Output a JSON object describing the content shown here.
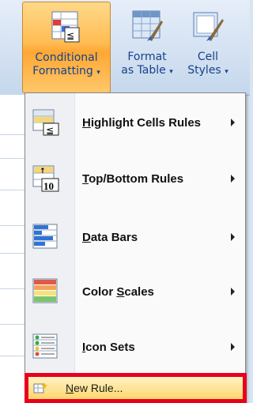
{
  "ribbon": {
    "conditional_formatting": {
      "line1": "Conditional",
      "line2": "Formatting",
      "dropdown": "▾"
    },
    "format_as_table": {
      "line1": "Format",
      "line2": "as Table",
      "dropdown": "▾"
    },
    "cell_styles": {
      "line1": "Cell",
      "line2": "Styles",
      "dropdown": "▾"
    }
  },
  "menu": {
    "items": [
      {
        "label_pre": "",
        "label_u": "H",
        "label_post": "ighlight Cells Rules",
        "icon": "highlight-cells-rules-icon",
        "has_submenu": true
      },
      {
        "label_pre": "",
        "label_u": "T",
        "label_post": "op/Bottom Rules",
        "icon": "top-bottom-rules-icon",
        "has_submenu": true
      },
      {
        "label_pre": "",
        "label_u": "D",
        "label_post": "ata Bars",
        "icon": "data-bars-icon",
        "has_submenu": true
      },
      {
        "label_pre": "Color ",
        "label_u": "S",
        "label_post": "cales",
        "icon": "color-scales-icon",
        "has_submenu": true
      },
      {
        "label_pre": "",
        "label_u": "I",
        "label_post": "con Sets",
        "icon": "icon-sets-icon",
        "has_submenu": true
      }
    ],
    "new_rule": {
      "label_pre": "",
      "label_u": "N",
      "label_post": "ew Rule...",
      "icon": "new-rule-icon"
    }
  },
  "colors": {
    "highlight_border": "#e8001c",
    "active_button": "#ffbc53"
  }
}
